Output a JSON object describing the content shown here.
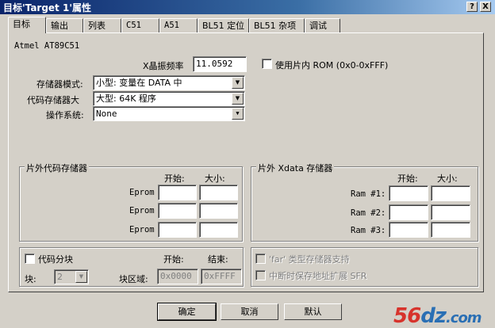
{
  "window": {
    "title": "目标'Target 1'属性"
  },
  "tabs": [
    "目标",
    "输出",
    "列表",
    "C51",
    "A51",
    "BL51 定位",
    "BL51 杂项",
    "调试"
  ],
  "device": "Atmel AT89C51",
  "xtal": {
    "label": "X晶振频率",
    "value": "11.0592"
  },
  "on_chip_rom": {
    "label": "使用片内 ROM (0x0-0xFFF)"
  },
  "memory_model": {
    "label": "存储器模式:",
    "value": "小型: 变量在 DATA 中"
  },
  "code_rom_size": {
    "label": "代码存储器大",
    "value": "大型: 64K 程序"
  },
  "os": {
    "label": "操作系统:",
    "value": "None"
  },
  "off_chip_code": {
    "title": "片外代码存储器",
    "start_label": "开始:",
    "size_label": "大小:",
    "rows": [
      "Eprom",
      "Eprom",
      "Eprom"
    ]
  },
  "off_chip_xdata": {
    "title": "片外 Xdata 存储器",
    "start_label": "开始:",
    "size_label": "大小:",
    "rows": [
      "Ram #1:",
      "Ram #2:",
      "Ram #3:"
    ]
  },
  "banking": {
    "label": "代码分块",
    "start_label": "开始:",
    "end_label": "结束:",
    "block_label": "块:",
    "block_value": "2",
    "range_label": "块区域:",
    "range_start": "0x0000",
    "range_end": "0xFFFF"
  },
  "far_memory": {
    "label": "'far' 类型存储器支持"
  },
  "save_address": {
    "label": "中断时保存地址扩展 SFR"
  },
  "buttons": {
    "ok": "确定",
    "cancel": "取消",
    "defaults": "默认"
  },
  "titlebar_buttons": {
    "help": "?",
    "close": "X"
  },
  "watermark": {
    "main": "56",
    "dz": "dz",
    "com": ".com"
  }
}
